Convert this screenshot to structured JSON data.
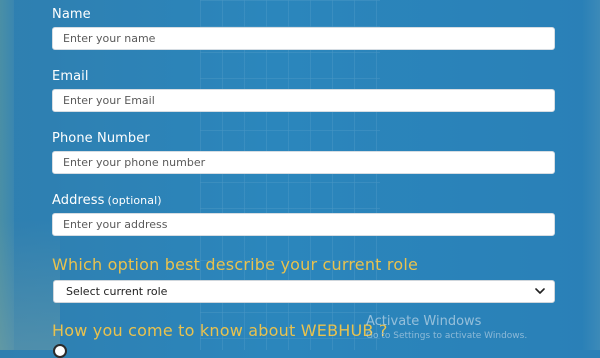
{
  "form": {
    "name": {
      "label": "Name",
      "placeholder": "Enter your name"
    },
    "email": {
      "label": "Email",
      "placeholder": "Enter your Email"
    },
    "phone": {
      "label": "Phone Number",
      "placeholder": "Enter your phone number"
    },
    "address": {
      "label": "Address",
      "optional": "(optional)",
      "placeholder": "Enter your address"
    },
    "role": {
      "question": "Which option best describe your current role",
      "selected": "Select current role",
      "icon": "chevron-down-icon"
    },
    "source": {
      "question": "How you come to know about WEBHUB ?"
    }
  },
  "watermark": {
    "title": "Activate Windows",
    "subtitle": "Go to Settings to activate Windows."
  },
  "colors": {
    "background": "#2b86bc",
    "question_text": "#e9c24e",
    "label_text": "#ffffff",
    "field_bg": "#ffffff"
  }
}
